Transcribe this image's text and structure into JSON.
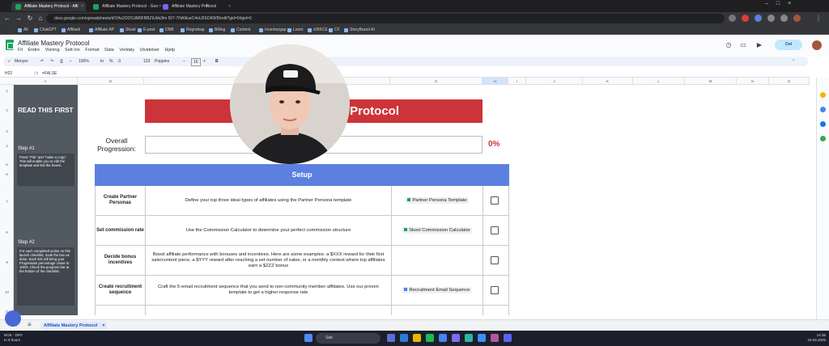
{
  "browser": {
    "tabs": [
      {
        "label": "Affiliate Mastery Protocol - Affi",
        "active": true
      },
      {
        "label": "Affiliate Mastery Protocol - Goo",
        "active": false
      },
      {
        "label": "Affiliate Mastery Protocol",
        "active": false
      }
    ],
    "new_tab": "+",
    "url": "docs.google.com/spreadsheets/d/1Ha2OOCdM9FBBZtUbb3lm 507-7HA9iueC4nU5SOKWB/edit?gid=0#gid=0",
    "bookmarks": [
      "All",
      "ChatGPT",
      "Affilasti",
      "Affiliate AP",
      "Skool",
      "E-post",
      "DNB",
      "Regnskap",
      "Billing",
      "Content",
      "Inventurgap",
      "Loom",
      "d:BKCE",
      "CF",
      "StoryBrand AI"
    ]
  },
  "doc": {
    "title": "Affiliate Mastery Protocol",
    "menu": [
      "Fil",
      "Endre",
      "Visning",
      "Sett inn",
      "Format",
      "Data",
      "Verktøy",
      "Utvidelser",
      "Hjelp"
    ],
    "share_label": "Del"
  },
  "toolbar": {
    "search_label": "Menyer",
    "zoom": "100%",
    "currency": "kr",
    "percent": "%",
    "decimals": ".0",
    "format": "123",
    "font": "Poppins",
    "font_size": "16"
  },
  "formula": {
    "cell_ref": "H22",
    "fx": "ƒx",
    "value": "=FALSE"
  },
  "columns": [
    "A",
    "B",
    "E",
    "F",
    "G",
    "H",
    "I",
    "J",
    "K",
    "L",
    "M",
    "N",
    "O",
    "P"
  ],
  "rows": [
    "1",
    "2",
    "3",
    "4",
    "5",
    "6",
    "7",
    "8",
    "9",
    "10",
    "11"
  ],
  "side": {
    "read_first": "READ THIS FIRST",
    "step1_title": "Step #1",
    "step1_text": "Press \"File\" and \"make a copy\". This will enable you to edit the template and tick the boxes.",
    "step2_title": "Step #2",
    "step2_text": "For each completed action on this launch checklist, mark the box as done. Each tick will bring your Progression percentage closer to 100%. Check the progress bar at the bottom of the checklist."
  },
  "main": {
    "title": "Affiliate Mastery Protocol",
    "title_visible": "Protocol",
    "overall_label": "Overall Progression:",
    "progress_percent": "0%",
    "progress_value": 0,
    "setup_header": "Setup"
  },
  "tasks": [
    {
      "name": "Create Partner Personas",
      "desc": "Define your top three ideal types of affiliates using the Partner Persona template",
      "link": "Partner Persona Template",
      "link_color": "green"
    },
    {
      "name": "Set commission rate",
      "desc": "Use the Commission Calculator to determine your perfect commission structure",
      "link": "Skool Commission Calculator",
      "link_color": "green"
    },
    {
      "name": "Decide bonus incentives",
      "desc": "Boost affiliate performance with bonuses and incentives. Here are some examples: a $XXX reward for their first sale/content piece, a $YYY reward after reaching a set number of sales, or a monthly contest where top affiliates earn a $ZZZ bonus",
      "link": "",
      "link_color": ""
    },
    {
      "name": "Create recruitment sequence",
      "desc": "Craft the 5-email recruitment sequence that you send to non-community member affiliates. Use our proven template to get a higher response rate",
      "link": "Recruitment Email Sequence",
      "link_color": "blue"
    }
  ],
  "sheet_tabs": {
    "add": "+",
    "menu": "≡",
    "active": "Affiliate Mastery Protocol"
  },
  "taskbar": {
    "weather_label": "NOK - DRY",
    "weather_sub": "In 6 hours",
    "search": "Søk",
    "time": "14:35",
    "date": "16.04.2025"
  },
  "colors": {
    "red": "#cc3439",
    "blue": "#5b80e0",
    "panel": "#515961",
    "green": "#1ea362"
  }
}
